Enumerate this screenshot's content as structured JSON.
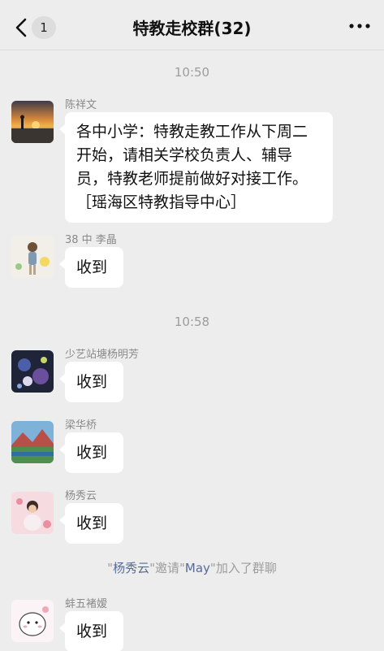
{
  "header": {
    "back_icon": "chevron-left-icon",
    "unread_count": "1",
    "title": "特教走校群(32)",
    "more_icon": "more-horizontal-icon"
  },
  "timestamps": [
    "10:50",
    "10:58"
  ],
  "messages": [
    {
      "sender": "陈祥文",
      "text": "各中小学：特教走教工作从下周二开始，请相关学校负责人、辅导员，特教老师提前做好对接工作。［瑶海区特教指导中心］"
    },
    {
      "sender": "38 中 李晶",
      "text": "收到"
    },
    {
      "sender": "少艺站塘杨明芳",
      "text": "收到"
    },
    {
      "sender": "梁华桥",
      "text": "收到"
    },
    {
      "sender": "杨秀云",
      "text": "收到"
    },
    {
      "sender": "蚌五褚嫒",
      "text": "收到"
    }
  ],
  "system_notice": {
    "q1": "\"",
    "inviter": "杨秀云",
    "q2": "\"",
    "verb": "邀请",
    "q3": "\"",
    "invitee": "May",
    "q4": "\"",
    "tail": "加入了群聊"
  },
  "colors": {
    "background": "#ededed",
    "bubble": "#ffffff",
    "link": "#576b95",
    "timestamp": "#9d9d9d"
  }
}
